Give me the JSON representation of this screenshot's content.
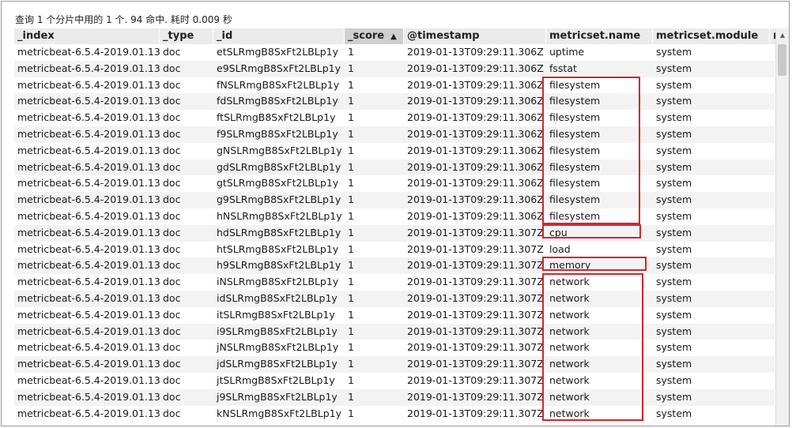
{
  "summary": "查询 1 个分片中用的 1 个. 94 命中. 耗时 0.009 秒",
  "columns": [
    {
      "key": "index",
      "label": "_index"
    },
    {
      "key": "type",
      "label": "_type"
    },
    {
      "key": "id",
      "label": "_id"
    },
    {
      "key": "score",
      "label": "_score",
      "sorted": true,
      "sort_indicator": "▲"
    },
    {
      "key": "timestamp",
      "label": "@timestamp"
    },
    {
      "key": "metricset_name",
      "label": "metricset.name"
    },
    {
      "key": "metricset_module",
      "label": "metricset.module"
    },
    {
      "key": "more",
      "label": "me"
    }
  ],
  "rows": [
    {
      "index": "metricbeat-6.5.4-2019.01.13",
      "type": "doc",
      "id": "etSLRmgB8SxFt2LBLp1y",
      "score": "1",
      "timestamp": "2019-01-13T09:29:11.306Z",
      "metricset_name": "uptime",
      "metricset_module": "system"
    },
    {
      "index": "metricbeat-6.5.4-2019.01.13",
      "type": "doc",
      "id": "e9SLRmgB8SxFt2LBLp1y",
      "score": "1",
      "timestamp": "2019-01-13T09:29:11.306Z",
      "metricset_name": "fsstat",
      "metricset_module": "system"
    },
    {
      "index": "metricbeat-6.5.4-2019.01.13",
      "type": "doc",
      "id": "fNSLRmgB8SxFt2LBLp1y",
      "score": "1",
      "timestamp": "2019-01-13T09:29:11.306Z",
      "metricset_name": "filesystem",
      "metricset_module": "system"
    },
    {
      "index": "metricbeat-6.5.4-2019.01.13",
      "type": "doc",
      "id": "fdSLRmgB8SxFt2LBLp1y",
      "score": "1",
      "timestamp": "2019-01-13T09:29:11.306Z",
      "metricset_name": "filesystem",
      "metricset_module": "system"
    },
    {
      "index": "metricbeat-6.5.4-2019.01.13",
      "type": "doc",
      "id": "ftSLRmgB8SxFt2LBLp1y",
      "score": "1",
      "timestamp": "2019-01-13T09:29:11.306Z",
      "metricset_name": "filesystem",
      "metricset_module": "system"
    },
    {
      "index": "metricbeat-6.5.4-2019.01.13",
      "type": "doc",
      "id": "f9SLRmgB8SxFt2LBLp1y",
      "score": "1",
      "timestamp": "2019-01-13T09:29:11.306Z",
      "metricset_name": "filesystem",
      "metricset_module": "system"
    },
    {
      "index": "metricbeat-6.5.4-2019.01.13",
      "type": "doc",
      "id": "gNSLRmgB8SxFt2LBLp1y",
      "score": "1",
      "timestamp": "2019-01-13T09:29:11.306Z",
      "metricset_name": "filesystem",
      "metricset_module": "system"
    },
    {
      "index": "metricbeat-6.5.4-2019.01.13",
      "type": "doc",
      "id": "gdSLRmgB8SxFt2LBLp1y",
      "score": "1",
      "timestamp": "2019-01-13T09:29:11.306Z",
      "metricset_name": "filesystem",
      "metricset_module": "system"
    },
    {
      "index": "metricbeat-6.5.4-2019.01.13",
      "type": "doc",
      "id": "gtSLRmgB8SxFt2LBLp1y",
      "score": "1",
      "timestamp": "2019-01-13T09:29:11.306Z",
      "metricset_name": "filesystem",
      "metricset_module": "system"
    },
    {
      "index": "metricbeat-6.5.4-2019.01.13",
      "type": "doc",
      "id": "g9SLRmgB8SxFt2LBLp1y",
      "score": "1",
      "timestamp": "2019-01-13T09:29:11.306Z",
      "metricset_name": "filesystem",
      "metricset_module": "system"
    },
    {
      "index": "metricbeat-6.5.4-2019.01.13",
      "type": "doc",
      "id": "hNSLRmgB8SxFt2LBLp1y",
      "score": "1",
      "timestamp": "2019-01-13T09:29:11.306Z",
      "metricset_name": "filesystem",
      "metricset_module": "system"
    },
    {
      "index": "metricbeat-6.5.4-2019.01.13",
      "type": "doc",
      "id": "hdSLRmgB8SxFt2LBLp1y",
      "score": "1",
      "timestamp": "2019-01-13T09:29:11.307Z",
      "metricset_name": "cpu",
      "metricset_module": "system"
    },
    {
      "index": "metricbeat-6.5.4-2019.01.13",
      "type": "doc",
      "id": "htSLRmgB8SxFt2LBLp1y",
      "score": "1",
      "timestamp": "2019-01-13T09:29:11.307Z",
      "metricset_name": "load",
      "metricset_module": "system"
    },
    {
      "index": "metricbeat-6.5.4-2019.01.13",
      "type": "doc",
      "id": "h9SLRmgB8SxFt2LBLp1y",
      "score": "1",
      "timestamp": "2019-01-13T09:29:11.307Z",
      "metricset_name": "memory",
      "metricset_module": "system"
    },
    {
      "index": "metricbeat-6.5.4-2019.01.13",
      "type": "doc",
      "id": "iNSLRmgB8SxFt2LBLp1y",
      "score": "1",
      "timestamp": "2019-01-13T09:29:11.307Z",
      "metricset_name": "network",
      "metricset_module": "system"
    },
    {
      "index": "metricbeat-6.5.4-2019.01.13",
      "type": "doc",
      "id": "idSLRmgB8SxFt2LBLp1y",
      "score": "1",
      "timestamp": "2019-01-13T09:29:11.307Z",
      "metricset_name": "network",
      "metricset_module": "system"
    },
    {
      "index": "metricbeat-6.5.4-2019.01.13",
      "type": "doc",
      "id": "itSLRmgB8SxFt2LBLp1y",
      "score": "1",
      "timestamp": "2019-01-13T09:29:11.307Z",
      "metricset_name": "network",
      "metricset_module": "system"
    },
    {
      "index": "metricbeat-6.5.4-2019.01.13",
      "type": "doc",
      "id": "i9SLRmgB8SxFt2LBLp1y",
      "score": "1",
      "timestamp": "2019-01-13T09:29:11.307Z",
      "metricset_name": "network",
      "metricset_module": "system"
    },
    {
      "index": "metricbeat-6.5.4-2019.01.13",
      "type": "doc",
      "id": "jNSLRmgB8SxFt2LBLp1y",
      "score": "1",
      "timestamp": "2019-01-13T09:29:11.307Z",
      "metricset_name": "network",
      "metricset_module": "system"
    },
    {
      "index": "metricbeat-6.5.4-2019.01.13",
      "type": "doc",
      "id": "jdSLRmgB8SxFt2LBLp1y",
      "score": "1",
      "timestamp": "2019-01-13T09:29:11.307Z",
      "metricset_name": "network",
      "metricset_module": "system"
    },
    {
      "index": "metricbeat-6.5.4-2019.01.13",
      "type": "doc",
      "id": "jtSLRmgB8SxFt2LBLp1y",
      "score": "1",
      "timestamp": "2019-01-13T09:29:11.307Z",
      "metricset_name": "network",
      "metricset_module": "system"
    },
    {
      "index": "metricbeat-6.5.4-2019.01.13",
      "type": "doc",
      "id": "j9SLRmgB8SxFt2LBLp1y",
      "score": "1",
      "timestamp": "2019-01-13T09:29:11.307Z",
      "metricset_name": "network",
      "metricset_module": "system"
    },
    {
      "index": "metricbeat-6.5.4-2019.01.13",
      "type": "doc",
      "id": "kNSLRmgB8SxFt2LBLp1y",
      "score": "1",
      "timestamp": "2019-01-13T09:29:11.307Z",
      "metricset_name": "network",
      "metricset_module": "system"
    }
  ],
  "highlight_color": "#d9232d",
  "highlights": [
    {
      "group": "filesystem"
    },
    {
      "group": "cpu"
    },
    {
      "group": "memory"
    },
    {
      "group": "network"
    }
  ]
}
